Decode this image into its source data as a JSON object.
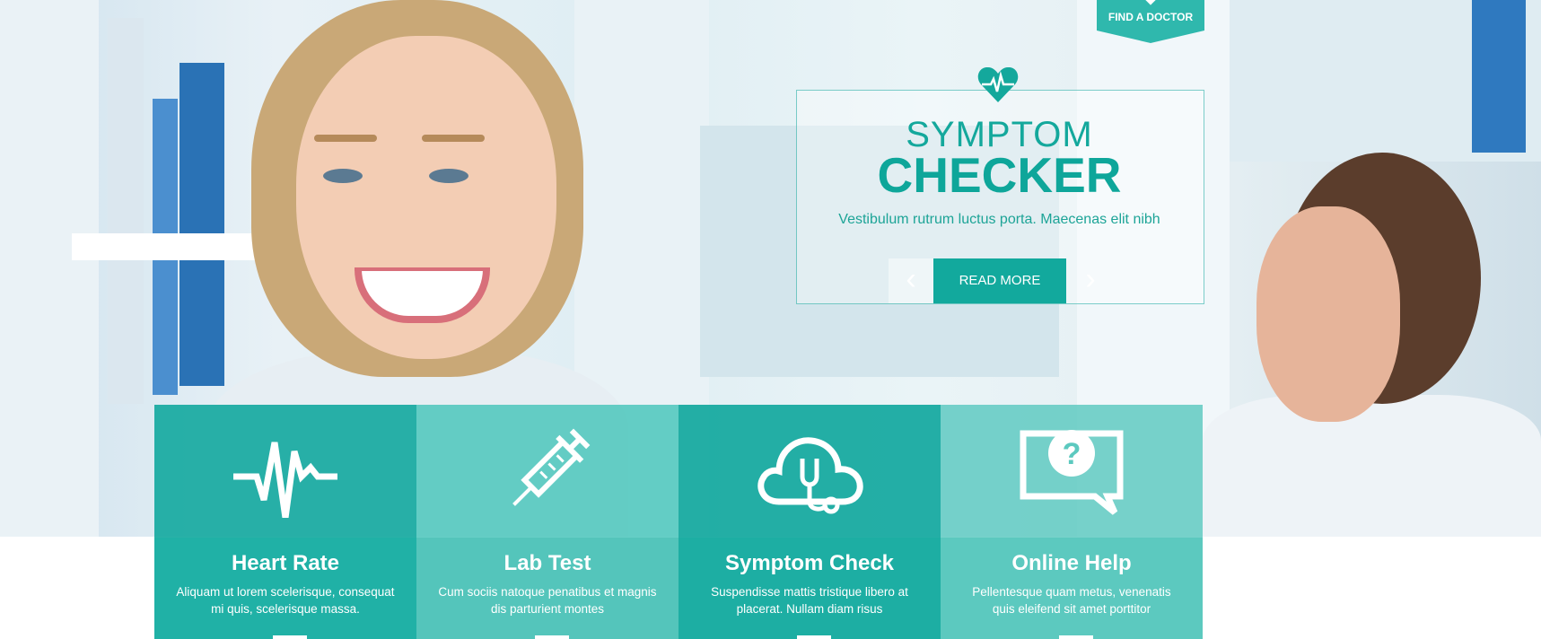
{
  "header": {
    "find_doctor_label": "FIND A DOCTOR"
  },
  "slider": {
    "title_line1": "SYMPTOM",
    "title_line2": "CHECKER",
    "description": "Vestibulum rutrum luctus porta. Maecenas elit nibh",
    "read_more_label": "READ MORE",
    "prev_arrow": "‹",
    "next_arrow": "›",
    "accent_color": "#14a89c"
  },
  "features": [
    {
      "icon": "heartbeat-icon",
      "title": "Heart Rate",
      "text": "Aliquam ut lorem scelerisque, consequat mi quis, scelerisque massa."
    },
    {
      "icon": "syringe-icon",
      "title": "Lab Test",
      "text": "Cum sociis natoque penatibus et magnis dis parturient montes"
    },
    {
      "icon": "cloud-stethoscope-icon",
      "title": "Symptom Check",
      "text": "Suspendisse mattis tristique libero at placerat. Nullam diam risus"
    },
    {
      "icon": "question-chat-icon",
      "title": "Online Help",
      "text": "Pellentesque quam metus, venenatis quis eleifend sit amet porttitor"
    }
  ]
}
